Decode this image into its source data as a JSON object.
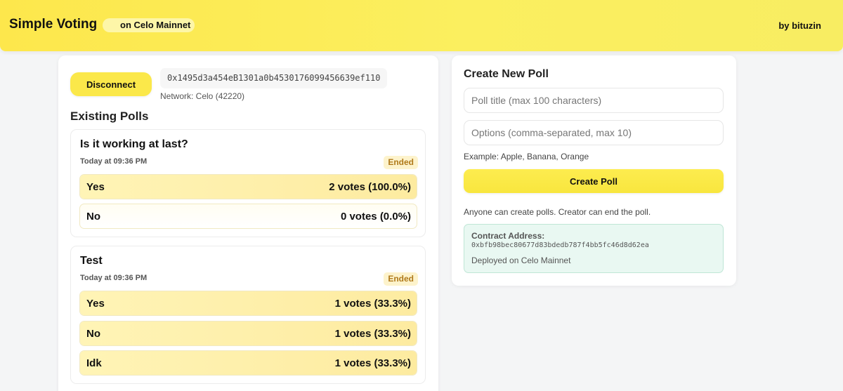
{
  "header": {
    "app_title": "Simple Voting",
    "network_badge": "on Celo Mainnet",
    "author": "by bituzin"
  },
  "wallet": {
    "disconnect_label": "Disconnect",
    "address": "0x1495d3a454eB1301a0b4530176099456639ef110",
    "network": "Network: Celo (42220)"
  },
  "polls_section": {
    "heading": "Existing Polls",
    "polls": [
      {
        "title": "Is it working at last?",
        "date": "Today at 09:36 PM",
        "status": "Ended",
        "options": [
          {
            "label": "Yes",
            "votes": "2 votes (100.0%)",
            "share": 100
          },
          {
            "label": "No",
            "votes": "0 votes (0.0%)",
            "share": 0
          }
        ]
      },
      {
        "title": "Test",
        "date": "Today at 09:36 PM",
        "status": "Ended",
        "options": [
          {
            "label": "Yes",
            "votes": "1 votes (33.3%)",
            "share": 100
          },
          {
            "label": "No",
            "votes": "1 votes (33.3%)",
            "share": 100
          },
          {
            "label": "Idk",
            "votes": "1 votes (33.3%)",
            "share": 100
          }
        ]
      }
    ]
  },
  "create_poll": {
    "heading": "Create New Poll",
    "title_placeholder": "Poll title (max 100 characters)",
    "options_placeholder": "Options (comma-separated, max 10)",
    "example": "Example: Apple, Banana, Orange",
    "button_label": "Create Poll",
    "info": "Anyone can create polls. Creator can end the poll.",
    "contract_label": "Contract Address:",
    "contract_address": "0xbfb98bec80677d83bdedb787f4bb5fc46d8d62ea",
    "deployment": "Deployed on Celo Mainnet"
  },
  "colors": {
    "accent_yellow": "#fbe84a",
    "status_text": "#b07a1a",
    "contract_box": "#e9f8f2"
  }
}
